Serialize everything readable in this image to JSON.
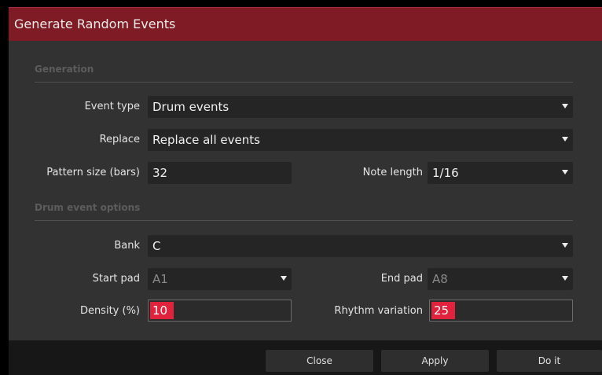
{
  "dialog": {
    "title": "Generate Random Events"
  },
  "generation": {
    "section_title": "Generation",
    "event_type": {
      "label": "Event type",
      "value": "Drum events"
    },
    "replace": {
      "label": "Replace",
      "value": "Replace all events"
    },
    "pattern_size": {
      "label": "Pattern size (bars)",
      "value": "32"
    },
    "note_length": {
      "label": "Note length",
      "value": "1/16"
    }
  },
  "drum_options": {
    "section_title": "Drum event options",
    "bank": {
      "label": "Bank",
      "value": "C"
    },
    "start_pad": {
      "label": "Start pad",
      "value": "A1"
    },
    "end_pad": {
      "label": "End pad",
      "value": "A8"
    },
    "density": {
      "label": "Density (%)",
      "value": "10"
    },
    "rhythm_variation": {
      "label": "Rhythm variation",
      "value": "25"
    }
  },
  "buttons": {
    "close": "Close",
    "apply": "Apply",
    "do_it": "Do it"
  },
  "colors": {
    "title_bar": "#7f1b24",
    "accent": "#e0223c",
    "panel": "#323232",
    "field": "#252525"
  },
  "icons": {
    "dropdown": "dropdown-arrow-icon"
  }
}
